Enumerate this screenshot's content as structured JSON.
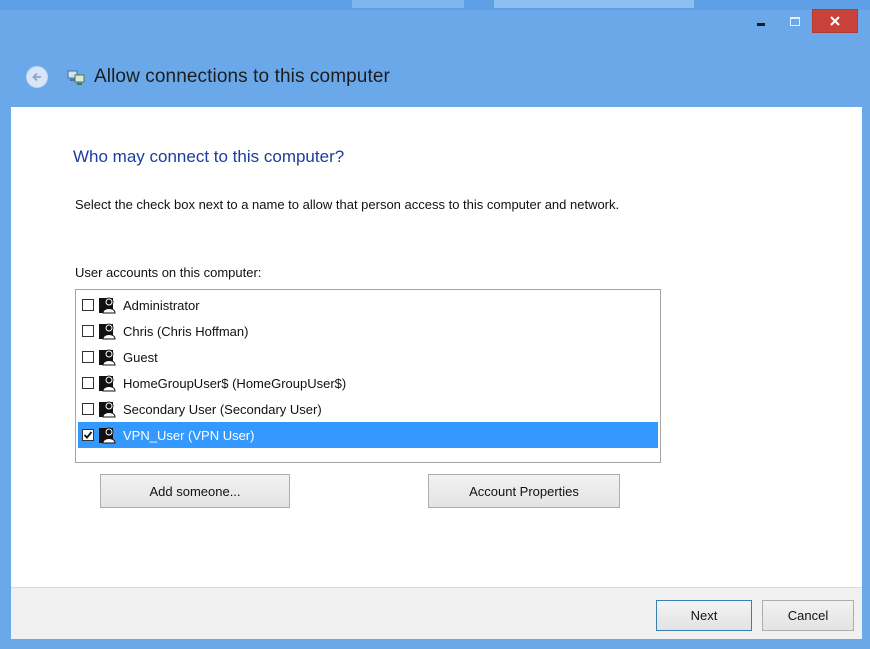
{
  "window": {
    "title": "Allow connections to this computer",
    "caption": {
      "close_label": "×"
    }
  },
  "main": {
    "heading": "Who may connect to this computer?",
    "description": "Select the check box next to a name to allow that person access to this computer and network.",
    "list_label": "User accounts on this computer:",
    "users": [
      {
        "name": "Administrator",
        "checked": false,
        "selected": false
      },
      {
        "name": "Chris (Chris Hoffman)",
        "checked": false,
        "selected": false
      },
      {
        "name": "Guest",
        "checked": false,
        "selected": false
      },
      {
        "name": "HomeGroupUser$ (HomeGroupUser$)",
        "checked": false,
        "selected": false
      },
      {
        "name": "Secondary User (Secondary User)",
        "checked": false,
        "selected": false
      },
      {
        "name": "VPN_User (VPN User)",
        "checked": true,
        "selected": true
      }
    ],
    "add_button": "Add someone...",
    "properties_button": "Account Properties"
  },
  "footer": {
    "next_button": "Next",
    "cancel_button": "Cancel"
  },
  "colors": {
    "frame": "#6aa8ea",
    "heading": "#1a3e9c",
    "selection": "#3399ff",
    "close": "#c9433b"
  }
}
